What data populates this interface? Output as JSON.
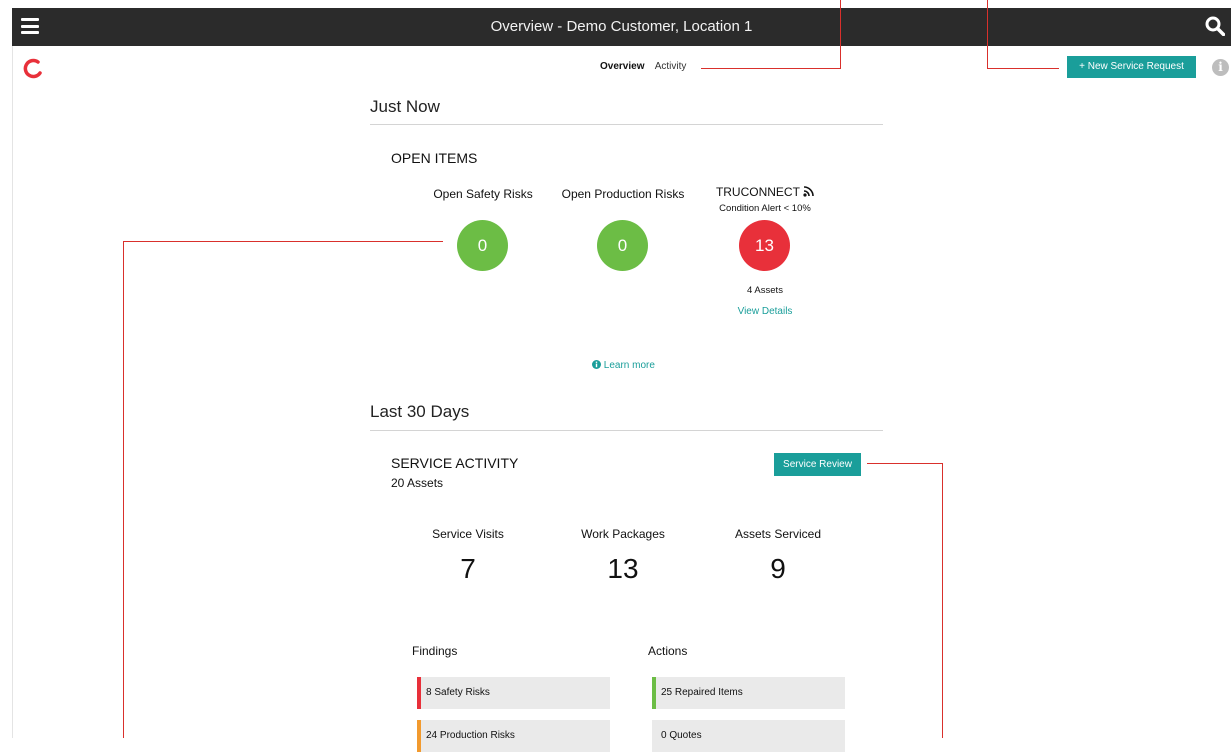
{
  "header": {
    "title": "Overview - Demo Customer, Location 1"
  },
  "tabs": {
    "overview": "Overview",
    "activity": "Activity"
  },
  "toolbar": {
    "new_request_label": "+ New Service Request"
  },
  "just_now": {
    "title": "Just Now",
    "open_items": {
      "title": "OPEN ITEMS",
      "safety": {
        "label": "Open Safety Risks",
        "value": "0"
      },
      "production": {
        "label": "Open Production Risks",
        "value": "0"
      },
      "truconnect": {
        "label": "TRUCONNECT",
        "sublabel": "Condition Alert < 10%",
        "value": "13",
        "assets": "4 Assets",
        "link": "View Details"
      },
      "learn_more": "Learn more"
    }
  },
  "last_30": {
    "title": "Last 30 Days",
    "service_activity": {
      "title": "SERVICE ACTIVITY",
      "assets": "20 Assets",
      "review_button": "Service Review",
      "stats": [
        {
          "label": "Service Visits",
          "value": "7"
        },
        {
          "label": "Work Packages",
          "value": "13"
        },
        {
          "label": "Assets Serviced",
          "value": "9"
        }
      ],
      "findings": {
        "title": "Findings",
        "items": [
          "8 Safety Risks",
          "24 Production Risks"
        ]
      },
      "actions": {
        "title": "Actions",
        "items": [
          "25 Repaired Items",
          "0 Quotes"
        ]
      }
    }
  },
  "colors": {
    "accent": "#1a9e9a",
    "green": "#6cbd45",
    "red": "#e8303a",
    "annotation": "#d9302c"
  }
}
